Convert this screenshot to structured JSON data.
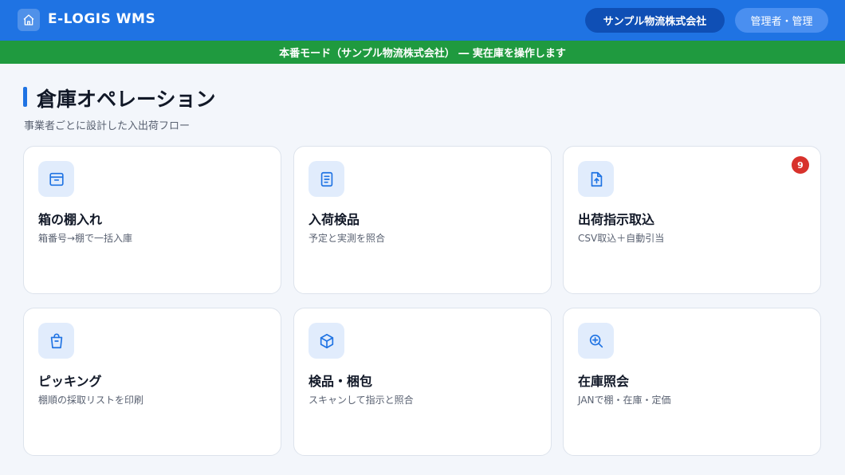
{
  "header": {
    "app_title": "E-LOGIS WMS",
    "company": "サンプル物流株式会社",
    "user": "管理者・管理",
    "home_icon": "home-icon"
  },
  "banner": {
    "text": "本番モード（サンプル物流株式会社） ― 実在庫を操作します"
  },
  "section": {
    "title": "倉庫オペレーション",
    "subtitle": "事業者ごとに設計した入出荷フロー"
  },
  "cards": [
    {
      "title": "箱の棚入れ",
      "desc": "箱番号→棚で一括入庫",
      "icon": "archive-box-icon"
    },
    {
      "title": "入荷検品",
      "desc": "予定と実測を照合",
      "icon": "document-icon"
    },
    {
      "title": "出荷指示取込",
      "desc": "CSV取込＋自動引当",
      "icon": "file-upload-icon",
      "badge": "9"
    },
    {
      "title": "ピッキング",
      "desc": "棚順の採取リストを印刷",
      "icon": "shopping-bag-icon"
    },
    {
      "title": "検品・梱包",
      "desc": "スキャンして指示と照合",
      "icon": "package-box-icon"
    },
    {
      "title": "在庫照会",
      "desc": "JANで棚・在庫・定価",
      "icon": "zoom-search-icon"
    }
  ],
  "colors": {
    "primary": "#1f73e3",
    "banner_green": "#1f9a3f",
    "badge_red": "#d8322c"
  }
}
